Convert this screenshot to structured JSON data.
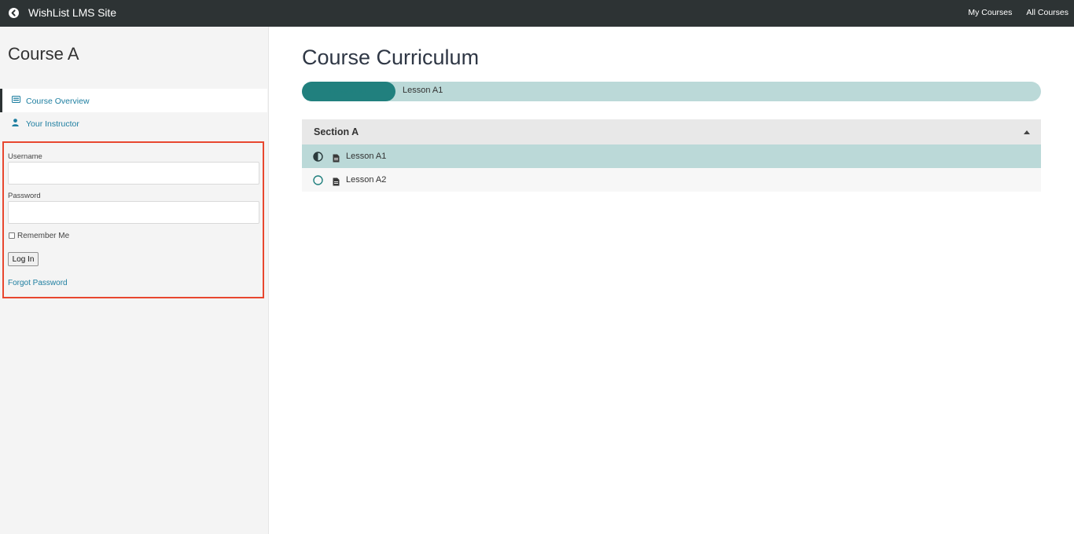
{
  "header": {
    "site_title": "WishList LMS Site",
    "nav": [
      "My Courses",
      "All Courses"
    ],
    "back_icon": "chevron-left-circle-icon"
  },
  "sidebar": {
    "course_title": "Course A",
    "items": [
      {
        "label": "Course Overview",
        "icon": "overview-icon",
        "active": true
      },
      {
        "label": "Your Instructor",
        "icon": "user-icon",
        "active": false
      }
    ],
    "login": {
      "username_label": "Username",
      "username_value": "",
      "password_label": "Password",
      "password_value": "",
      "remember_label": "Remember Me",
      "remember_checked": false,
      "login_button": "Log In",
      "forgot_link": "Forgot Password",
      "highlight_color": "#e8472f"
    }
  },
  "main": {
    "title": "Course Curriculum",
    "progress": {
      "label": "Lesson A1",
      "fill_fraction": 0.127,
      "fill_color": "#21807e",
      "track_color": "#bbd9d8"
    },
    "sections": [
      {
        "title": "Section A",
        "expanded": true,
        "lessons": [
          {
            "label": "Lesson A1",
            "status": "in-progress",
            "current": true
          },
          {
            "label": "Lesson A2",
            "status": "not-started",
            "current": false
          }
        ]
      }
    ]
  },
  "colors": {
    "topbar": "#2d3334",
    "link": "#1d7ea0",
    "accent": "#21807e"
  }
}
